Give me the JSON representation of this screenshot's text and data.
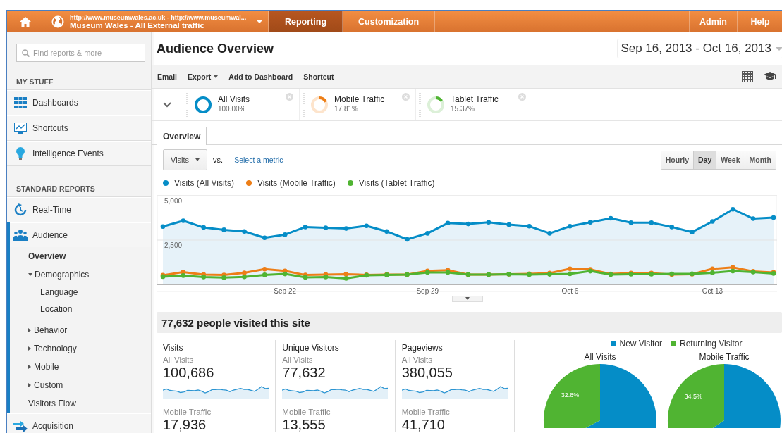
{
  "header": {
    "property_url": "http://www.museumwales.ac.uk - http://www.museumwal...",
    "property_name": "Museum Wales - All External traffic",
    "tabs": [
      {
        "label": "Reporting",
        "selected": true
      },
      {
        "label": "Customization",
        "selected": false
      }
    ],
    "links": [
      "Admin",
      "Help"
    ]
  },
  "sidebar": {
    "search": {
      "placeholder": "Find reports & more"
    },
    "sections": [
      {
        "title": "MY STUFF",
        "items": [
          {
            "label": "Dashboards",
            "selected": false
          },
          {
            "label": "Shortcuts",
            "selected": false
          },
          {
            "label": "Intelligence Events",
            "selected": false
          }
        ]
      },
      {
        "title": "STANDARD REPORTS",
        "items": [
          {
            "label": "Real-Time",
            "selected": false
          },
          {
            "label": "Audience",
            "selected": true,
            "expanded": true,
            "children": [
              {
                "label": "Overview",
                "selected": true
              },
              {
                "label": "Demographics",
                "selected": false,
                "expanded": true,
                "children": [
                  {
                    "label": "Language",
                    "selected": false
                  },
                  {
                    "label": "Location",
                    "selected": false
                  }
                ]
              },
              {
                "label": "Behavior",
                "selected": false,
                "expanded": false
              },
              {
                "label": "Technology",
                "selected": false,
                "expanded": false
              },
              {
                "label": "Mobile",
                "selected": false,
                "expanded": false
              },
              {
                "label": "Custom",
                "selected": false,
                "expanded": false
              },
              {
                "label": "Visitors Flow",
                "selected": false
              }
            ]
          },
          {
            "label": "Acquisition",
            "selected": false
          }
        ]
      }
    ]
  },
  "report": {
    "title": "Audience Overview",
    "date_range": "Sep 16, 2013 - Oct 16, 2013",
    "toolbar": [
      {
        "label": "Email",
        "dropdown": false
      },
      {
        "label": "Export",
        "dropdown": true
      },
      {
        "label": "Add to Dashboard",
        "dropdown": false
      },
      {
        "label": "Shortcut",
        "dropdown": false
      }
    ],
    "segments": [
      {
        "name": "All Visits",
        "share": "100.00%",
        "level": 1.0,
        "color": "#058dc7"
      },
      {
        "name": "Mobile Traffic",
        "share": "17.81%",
        "level": 0.1781,
        "color": "#ed7e17"
      },
      {
        "name": "Tablet Traffic",
        "share": "15.37%",
        "level": 0.1537,
        "color": "#50b432"
      }
    ],
    "tabs": [
      {
        "label": "Overview",
        "selected": true
      }
    ],
    "metric": {
      "value": "Visits",
      "vs": "vs.",
      "link": "Select a metric"
    },
    "granularity": [
      {
        "label": "Hourly",
        "selected": false
      },
      {
        "label": "Day",
        "selected": true
      },
      {
        "label": "Week",
        "selected": false
      },
      {
        "label": "Month",
        "selected": false
      }
    ],
    "chart_data": {
      "type": "line",
      "categories": [
        null,
        null,
        null,
        null,
        null,
        null,
        "Sep 22",
        null,
        null,
        null,
        null,
        null,
        null,
        "Sep 29",
        null,
        null,
        null,
        null,
        null,
        null,
        "Oct 6",
        null,
        null,
        null,
        null,
        null,
        null,
        "Oct 13",
        null,
        null,
        null
      ],
      "yticks": [
        {
          "value": 2500,
          "label": "2,500"
        },
        {
          "value": 5000,
          "label": "5,000"
        }
      ],
      "ylim": [
        0,
        5000
      ],
      "series": [
        {
          "name": "Visits (All Visits)",
          "type": "area",
          "color": "#058dc7",
          "values": [
            3260,
            3590,
            3210,
            3080,
            2990,
            2630,
            2810,
            3240,
            3190,
            3150,
            3300,
            2990,
            2540,
            2880,
            3460,
            3410,
            3500,
            3370,
            3280,
            2880,
            3280,
            3500,
            3730,
            3480,
            3480,
            3240,
            2950,
            3550,
            4240,
            3710,
            3770
          ]
        },
        {
          "name": "Visits (Mobile Traffic)",
          "type": "line",
          "color": "#ed7e17",
          "values": [
            520,
            700,
            560,
            530,
            650,
            860,
            760,
            530,
            560,
            580,
            540,
            560,
            560,
            760,
            800,
            560,
            560,
            580,
            600,
            640,
            880,
            850,
            590,
            640,
            640,
            550,
            580,
            880,
            960,
            740,
            680
          ]
        },
        {
          "name": "Visits (Tablet Traffic)",
          "type": "line",
          "color": "#50b432",
          "values": [
            440,
            500,
            420,
            390,
            430,
            540,
            590,
            400,
            420,
            340,
            520,
            540,
            550,
            680,
            680,
            560,
            560,
            580,
            560,
            570,
            600,
            750,
            560,
            580,
            580,
            590,
            600,
            660,
            750,
            700,
            620
          ]
        }
      ]
    }
  },
  "summary": {
    "headline": "77,632 people visited this site",
    "metrics": [
      {
        "name": "Visits",
        "rows": [
          {
            "segment": "All Visits",
            "value": "100,686"
          },
          {
            "segment": "Mobile Traffic",
            "value": "17,936"
          }
        ]
      },
      {
        "name": "Unique Visitors",
        "rows": [
          {
            "segment": "All Visits",
            "value": "77,632"
          },
          {
            "segment": "Mobile Traffic",
            "value": "13,555"
          }
        ]
      },
      {
        "name": "Pageviews",
        "rows": [
          {
            "segment": "All Visits",
            "value": "380,055"
          },
          {
            "segment": "Mobile Traffic",
            "value": "41,710"
          }
        ]
      }
    ],
    "pie_legend": [
      {
        "label": "New Visitor",
        "color": "#058dc7"
      },
      {
        "label": "Returning Visitor",
        "color": "#50b432"
      }
    ],
    "pie_charts": [
      {
        "chart_data": {
          "type": "pie",
          "title": "All Visits",
          "values": [
            67.2,
            32.8
          ],
          "value_labels": [
            null,
            "32.8%"
          ]
        }
      },
      {
        "chart_data": {
          "type": "pie",
          "title": "Mobile Traffic",
          "values": [
            65.5,
            34.5
          ],
          "value_labels": [
            null,
            "34.5%"
          ]
        }
      }
    ]
  }
}
